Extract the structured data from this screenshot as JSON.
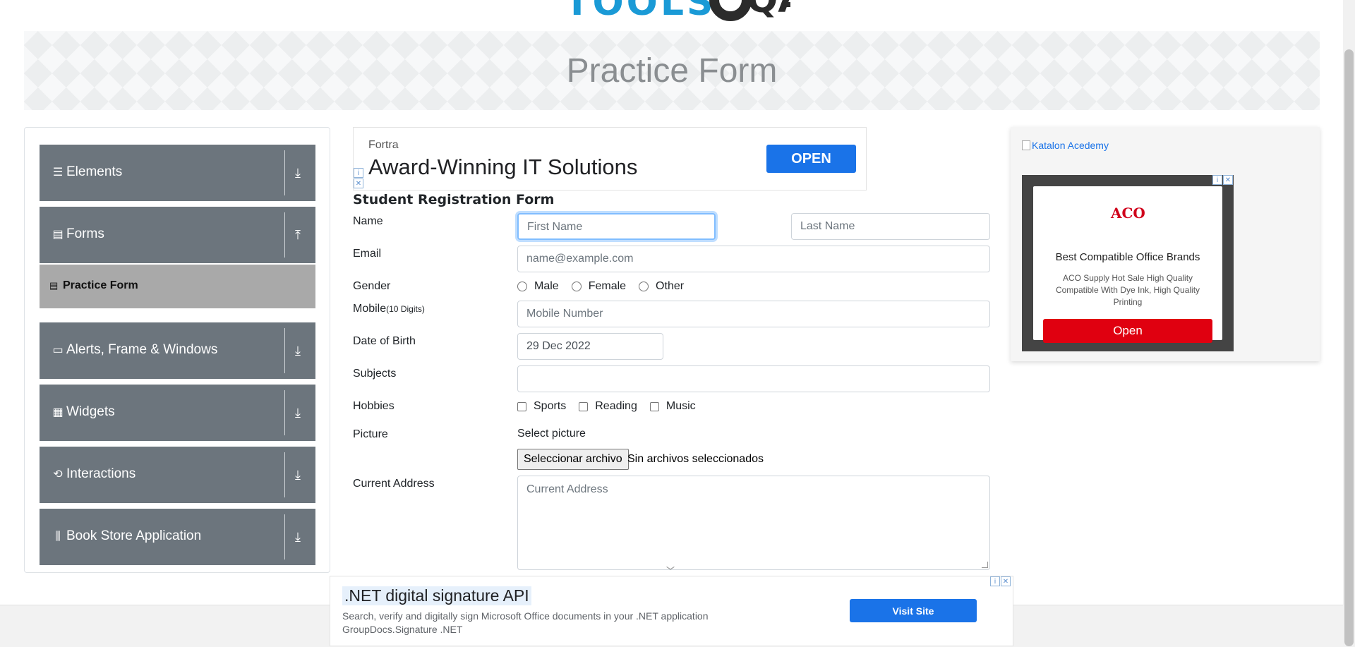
{
  "header": {
    "page_title": "Practice Form"
  },
  "sidebar": {
    "groups": [
      {
        "label": "Elements",
        "icon": "hamburger-icon",
        "arrow": "download-arrow"
      },
      {
        "label": "Forms",
        "icon": "document-icon",
        "arrow": "upload-arrow"
      },
      {
        "label": "Alerts, Frame & Windows",
        "icon": "window-icon",
        "arrow": "download-arrow"
      },
      {
        "label": "Widgets",
        "icon": "widgets-icon",
        "arrow": "download-arrow"
      },
      {
        "label": "Interactions",
        "icon": "refresh-icon",
        "arrow": "download-arrow"
      },
      {
        "label": "Book Store Application",
        "icon": "books-icon",
        "arrow": "download-arrow"
      }
    ],
    "active_item": {
      "label": "Practice Form"
    }
  },
  "ad_top": {
    "advertiser": "Fortra",
    "headline": "Award-Winning IT Solutions",
    "button": "OPEN"
  },
  "form": {
    "title": "Student Registration Form",
    "labels": {
      "name": "Name",
      "email": "Email",
      "gender": "Gender",
      "mobile": "Mobile",
      "mobile_hint": "(10 Digits)",
      "dob": "Date of Birth",
      "subjects": "Subjects",
      "hobbies": "Hobbies",
      "picture": "Picture",
      "address": "Current Address"
    },
    "placeholders": {
      "first_name": "First Name",
      "last_name": "Last Name",
      "email": "name@example.com",
      "mobile": "Mobile Number",
      "address": "Current Address"
    },
    "dob_value": "29 Dec 2022",
    "subjects_value": "",
    "gender_options": [
      "Male",
      "Female",
      "Other"
    ],
    "hobby_options": [
      "Sports",
      "Reading",
      "Music"
    ],
    "picture_prompt": "Select picture",
    "file_button": "Seleccionar archivo",
    "file_status": "Sin archivos seleccionados"
  },
  "ad_right": {
    "link_text": "Katalon Acedemy",
    "brand": "ACO",
    "title": "Best Compatible Office Brands",
    "description": "ACO Supply Hot Sale High Quality Compatible With Dye Ink, High Quality Printing",
    "button": "Open"
  },
  "ad_bottom": {
    "headline": ".NET digital signature API",
    "description": "Search, verify and digitally sign Microsoft Office documents in your .NET application",
    "brand": "GroupDocs.Signature .NET",
    "button": "Visit Site"
  },
  "colors": {
    "accent": "#1a73e8",
    "sidebar_group": "#6c757d",
    "sidebar_active": "#a9a9a9",
    "focus_border": "#80bdff",
    "ad_red": "#e00010"
  }
}
